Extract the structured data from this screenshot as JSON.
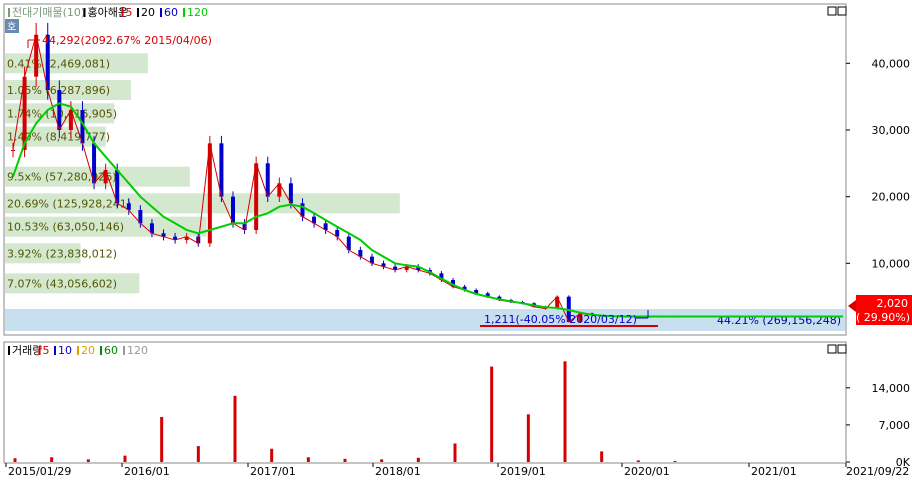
{
  "top_panel": {
    "legend": [
      {
        "text": "전대기매물(10)",
        "color": "#7a9a7a"
      },
      {
        "text": "홍아해운",
        "color": "#000000"
      },
      {
        "text": "5",
        "color": "#d40000"
      },
      {
        "text": "20",
        "color": "#000000"
      },
      {
        "text": "60",
        "color": "#0000cc"
      },
      {
        "text": "120",
        "color": "#00cc00"
      }
    ],
    "side_badge": "호",
    "y_ticks": [
      "40,000",
      "30,000",
      "20,000",
      "10,000"
    ],
    "high_annotation": "44,292(2092.67% 2015/04/06)",
    "low_annotation": "1,211(-40.05% 2020/03/12)",
    "current_price": "2,020",
    "current_change": "( 29.90%)"
  },
  "bottom_panel": {
    "legend": [
      {
        "text": "거래량",
        "color": "#000000"
      },
      {
        "text": "5",
        "color": "#d40000"
      },
      {
        "text": "10",
        "color": "#0000cc"
      },
      {
        "text": "20",
        "color": "#e0a000"
      },
      {
        "text": "60",
        "color": "#008800"
      },
      {
        "text": "120",
        "color": "#999999"
      }
    ],
    "y_ticks": [
      "14,000",
      "7,000",
      "0K"
    ]
  },
  "x_ticks": [
    "2015/01/29",
    "2016/01",
    "2017/01",
    "2018/01",
    "2019/01",
    "2020/01",
    "2021/01",
    "2021/09/22"
  ],
  "colors": {
    "price_up": "#d40000",
    "price_down": "#0000cc",
    "ma5": "#d40000",
    "ma20": "#000000",
    "ma60": "#0000cc",
    "ma120": "#00cc00",
    "vp_green": "#d4e8d0",
    "vp_blue": "#c8dff0",
    "vp_label": "#555500",
    "annot_red": "#d40000",
    "vol_bar": "#d40000"
  },
  "chart_data": [
    {
      "type": "line",
      "title": "홍아해운",
      "x": [
        "2015/01/29",
        "2015/03",
        "2015/04/06",
        "2015/05",
        "2015/06",
        "2015/07",
        "2015/08",
        "2015/09",
        "2015/10",
        "2015/11",
        "2015/12",
        "2016/01",
        "2016/02",
        "2016/03",
        "2016/04",
        "2016/05",
        "2016/06",
        "2016/07",
        "2016/08",
        "2016/09",
        "2016/10",
        "2016/11",
        "2016/12",
        "2017/01",
        "2017/02",
        "2017/03",
        "2017/04",
        "2017/05",
        "2017/06",
        "2017/07",
        "2017/08",
        "2017/09",
        "2017/10",
        "2017/11",
        "2017/12",
        "2018/01",
        "2018/03",
        "2018/05",
        "2018/07",
        "2018/09",
        "2018/11",
        "2019/01",
        "2019/03",
        "2019/05",
        "2019/07",
        "2019/09",
        "2019/11",
        "2020/01",
        "2020/03/12",
        "2020/05",
        "2020/07",
        "2020/09",
        "2020/11",
        "2021/01",
        "2021/03",
        "2021/05",
        "2021/07",
        "2021/09/22"
      ],
      "series": [
        {
          "name": "5",
          "values": [
            27000,
            38000,
            44292,
            36000,
            30000,
            33000,
            28000,
            22000,
            24000,
            19000,
            18000,
            16000,
            14500,
            14000,
            13500,
            14000,
            13000,
            28000,
            20000,
            16000,
            15000,
            25000,
            20000,
            22000,
            19000,
            17000,
            16000,
            15000,
            14000,
            12000,
            11000,
            10000,
            9500,
            9000,
            9500,
            9000,
            8500,
            7500,
            6500,
            6000,
            5500,
            5000,
            4500,
            4200,
            4000,
            3500,
            3200,
            5000,
            1211,
            2500,
            2200,
            2100,
            2050,
            2020,
            2020,
            2020,
            2020,
            2020
          ]
        },
        {
          "name": "120",
          "values": [
            23000,
            28000,
            31000,
            33000,
            34000,
            33500,
            31000,
            28000,
            26000,
            24000,
            22000,
            20000,
            18500,
            17000,
            16000,
            15000,
            14500,
            15000,
            15500,
            16000,
            16000,
            17000,
            17500,
            18500,
            18800,
            18500,
            17500,
            16500,
            15500,
            14500,
            13500,
            12000,
            11000,
            10000,
            9700,
            9500,
            8700,
            7700,
            6800,
            6000,
            5400,
            5000,
            4600,
            4300,
            4000,
            3700,
            3400,
            3300,
            3000,
            2600,
            2300,
            2150,
            2050,
            2020,
            2020,
            2020,
            2020,
            2020
          ]
        }
      ],
      "ylim": [
        0,
        48000
      ],
      "grid": false,
      "volume_profile": [
        {
          "label": "0.41% (2,469,081)",
          "price": 40000,
          "width": 0.17
        },
        {
          "label": "1.05% (6,287,896)",
          "price": 36000,
          "width": 0.15
        },
        {
          "label": "1.74% (10,416,905)",
          "price": 32500,
          "width": 0.13
        },
        {
          "label": "1.40% (8,419,777)",
          "price": 29000,
          "width": 0.12
        },
        {
          "label": "9.5x% (57,280,926)",
          "price": 23000,
          "width": 0.22
        },
        {
          "label": "20.69% (125,928,241)",
          "price": 19000,
          "width": 0.47
        },
        {
          "label": "10.53% (63,050,146)",
          "price": 15500,
          "width": 0.24
        },
        {
          "label": "3.92% (23,838,012)",
          "price": 11500,
          "width": 0.09
        },
        {
          "label": "7.07% (43,056,602)",
          "price": 7000,
          "width": 0.16
        },
        {
          "label": "44.21% (269,156,248)",
          "price": 1500,
          "width": 1.0
        }
      ]
    },
    {
      "type": "bar",
      "title": "거래량",
      "x": [
        "2015/01",
        "2015/06",
        "2016/01",
        "2016/06",
        "2016/08",
        "2016/11",
        "2017/01",
        "2017/06",
        "2018/01",
        "2018/06",
        "2019/01",
        "2019/06",
        "2019/09",
        "2019/11",
        "2020/02",
        "2020/03",
        "2020/06",
        "2021/01",
        "2021/09"
      ],
      "values": [
        700,
        900,
        500,
        1200,
        8500,
        3000,
        12500,
        2500,
        900,
        600,
        500,
        800,
        3500,
        18000,
        9000,
        19000,
        2000,
        300,
        200
      ],
      "ylim": [
        0,
        20000
      ]
    }
  ]
}
